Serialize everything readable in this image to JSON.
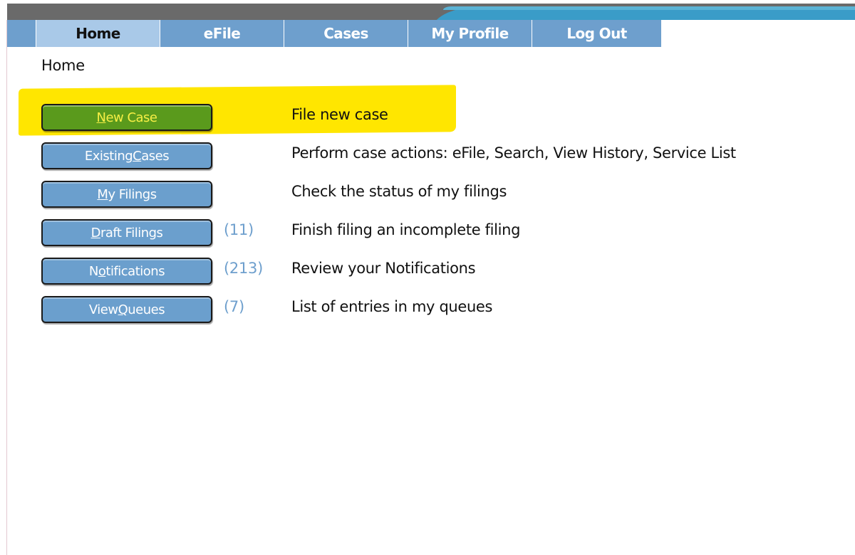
{
  "nav": {
    "tabs": [
      {
        "label": "Home",
        "active": true
      },
      {
        "label": "eFile",
        "active": false
      },
      {
        "label": "Cases",
        "active": false
      },
      {
        "label": "My Profile",
        "active": false
      },
      {
        "label": "Log Out",
        "active": false
      }
    ]
  },
  "breadcrumb": "Home",
  "actions": [
    {
      "button_pre": "",
      "button_key": "N",
      "button_post": "ew Case",
      "count": "",
      "description": "File new case",
      "style": "green",
      "highlighted": true
    },
    {
      "button_pre": "Existing ",
      "button_key": "C",
      "button_post": "ases",
      "count": "",
      "description": "Perform case actions: eFile, Search, View History, Service List",
      "style": "blue",
      "highlighted": false
    },
    {
      "button_pre": "",
      "button_key": "M",
      "button_post": "y Filings",
      "count": "",
      "description": "Check the status of my filings",
      "style": "blue",
      "highlighted": false
    },
    {
      "button_pre": "",
      "button_key": "D",
      "button_post": "raft Filings",
      "count": "(11)",
      "description": "Finish filing an incomplete filing",
      "style": "blue",
      "highlighted": false
    },
    {
      "button_pre": "N",
      "button_key": "o",
      "button_post": "tifications",
      "count": "(213)",
      "description": "Review your Notifications",
      "style": "blue",
      "highlighted": false
    },
    {
      "button_pre": "View ",
      "button_key": "Q",
      "button_post": "ueues",
      "count": "(7)",
      "description": "List of entries in my queues",
      "style": "blue",
      "highlighted": false
    }
  ],
  "colors": {
    "nav_tab": "#6e9fcd",
    "nav_tab_active": "#a9c9e8",
    "button_blue": "#6b9fcd",
    "button_green": "#5a9a1c",
    "highlight": "#ffe600",
    "count_text": "#6e9fcd"
  }
}
